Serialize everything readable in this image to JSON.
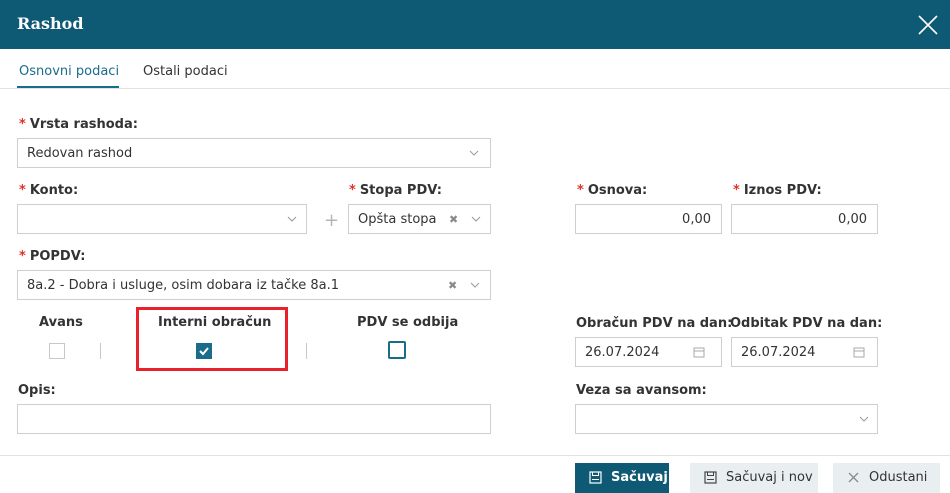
{
  "dialog": {
    "title": "Rashod"
  },
  "tabs": [
    {
      "label": "Osnovni podaci",
      "active": true
    },
    {
      "label": "Ostali podaci",
      "active": false
    }
  ],
  "required_marker": "*",
  "form": {
    "vrsta_rashoda": {
      "label": "Vrsta rashoda:",
      "value": "Redovan rashod"
    },
    "konto": {
      "label": "Konto:",
      "value": ""
    },
    "stopa_pdv": {
      "label": "Stopa PDV:",
      "value": "Opšta stopa"
    },
    "osnova": {
      "label": "Osnova:",
      "value": "0,00"
    },
    "iznos_pdv": {
      "label": "Iznos PDV:",
      "value": "0,00"
    },
    "popdv": {
      "label": "POPDV:",
      "value": "8a.2 - Dobra i usluge, osim dobara iz tačke 8a.1"
    },
    "avans": {
      "label": "Avans",
      "checked": false
    },
    "interni_obracun": {
      "label": "Interni obračun",
      "checked": true
    },
    "pdv_se_odbija": {
      "label": "PDV se odbija",
      "checked": false
    },
    "obracun_pdv_na_dan": {
      "label": "Obračun PDV na dan:",
      "value": "26.07.2024"
    },
    "odbitak_pdv_na_dan": {
      "label": "Odbitak PDV na dan:",
      "value": "26.07.2024"
    },
    "opis": {
      "label": "Opis:",
      "value": ""
    },
    "veza_sa_avansom": {
      "label": "Veza sa avansom:",
      "value": ""
    }
  },
  "buttons": {
    "save": "Sačuvaj",
    "save_new": "Sačuvaj i nov",
    "cancel": "Odustani"
  },
  "icons": {
    "close": "close-icon",
    "chevron": "chevron-down-icon",
    "clear": "clear-icon",
    "calendar": "calendar-icon",
    "save": "save-icon",
    "cancel": "close-icon"
  },
  "colors": {
    "header": "#0e5a74",
    "accent": "#1a6c8b",
    "required": "#e0322b",
    "highlight": "#e8212b",
    "secondary_button": "#e9eef1"
  }
}
